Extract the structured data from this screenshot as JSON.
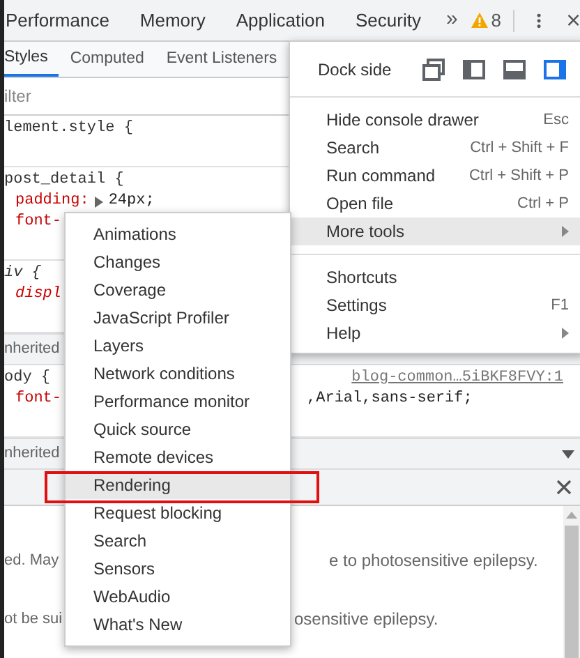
{
  "main_tabs": [
    {
      "label": "Performance",
      "selected": false
    },
    {
      "label": "Memory",
      "selected": false
    },
    {
      "label": "Application",
      "selected": false
    },
    {
      "label": "Security",
      "selected": false
    }
  ],
  "overflow": "»",
  "warnings": {
    "count": "8"
  },
  "subtabs": [
    {
      "label": "Styles",
      "selected": true
    },
    {
      "label": "Computed",
      "selected": false
    },
    {
      "label": "Event Listeners",
      "selected": false
    }
  ],
  "filter": {
    "placeholder": "ilter"
  },
  "rules": [
    {
      "kind": "rule",
      "selector": "lement.style {"
    },
    {
      "kind": "rule",
      "selector": "post_detail {",
      "lines": [
        {
          "kind": "expand",
          "prop": "padding:",
          "value": "24px;"
        },
        {
          "kind": "cut",
          "prop": "font-"
        }
      ]
    },
    {
      "kind": "rule",
      "selector": "iv {",
      "italic": true,
      "lines": [
        {
          "kind": "cut",
          "prop": "displ",
          "italic": true
        }
      ]
    },
    {
      "kind": "inherited",
      "label": "nherited"
    },
    {
      "kind": "rule",
      "selector": "ody {",
      "source": "blog-common…5iBKF8FVY:1",
      "lines": [
        {
          "kind": "split",
          "prop": "font-",
          "value": ",Arial,sans-serif;"
        }
      ]
    },
    {
      "kind": "inherited",
      "label": "nherited",
      "dropdown": true
    }
  ],
  "drawer": {
    "lines": [
      {
        "left": "ed. May",
        "right": "e to photosensitive epilepsy."
      },
      {
        "left": "ot be sui",
        "right": "osensitive epilepsy."
      }
    ]
  },
  "main_menu": {
    "dock": {
      "label": "Dock side",
      "options": [
        {
          "kind": "undock",
          "selected": false
        },
        {
          "kind": "left",
          "selected": false
        },
        {
          "kind": "bottom",
          "selected": false
        },
        {
          "kind": "right",
          "selected": true
        }
      ]
    },
    "groups": [
      [
        {
          "label": "Hide console drawer",
          "shortcut": "Esc",
          "selected": false
        },
        {
          "label": "Search",
          "shortcut": "Ctrl + Shift + F",
          "selected": false
        },
        {
          "label": "Run command",
          "shortcut": "Ctrl + Shift + P",
          "selected": false
        },
        {
          "label": "Open file",
          "shortcut": "Ctrl + P",
          "selected": false
        },
        {
          "label": "More tools",
          "submenu": true,
          "selected": true
        }
      ],
      [
        {
          "label": "Shortcuts",
          "selected": false
        },
        {
          "label": "Settings",
          "shortcut": "F1",
          "selected": false
        },
        {
          "label": "Help",
          "submenu": true,
          "selected": false
        }
      ]
    ]
  },
  "submenu": {
    "items": [
      {
        "label": "Animations",
        "selected": false
      },
      {
        "label": "Changes",
        "selected": false
      },
      {
        "label": "Coverage",
        "selected": false
      },
      {
        "label": "JavaScript Profiler",
        "selected": false
      },
      {
        "label": "Layers",
        "selected": false
      },
      {
        "label": "Network conditions",
        "selected": false
      },
      {
        "label": "Performance monitor",
        "selected": false
      },
      {
        "label": "Quick source",
        "selected": false
      },
      {
        "label": "Remote devices",
        "selected": false
      },
      {
        "label": "Rendering",
        "selected": true,
        "annotated": true
      },
      {
        "label": "Request blocking",
        "selected": false
      },
      {
        "label": "Search",
        "selected": false
      },
      {
        "label": "Sensors",
        "selected": false
      },
      {
        "label": "WebAudio",
        "selected": false
      },
      {
        "label": "What's New",
        "selected": false
      }
    ]
  }
}
